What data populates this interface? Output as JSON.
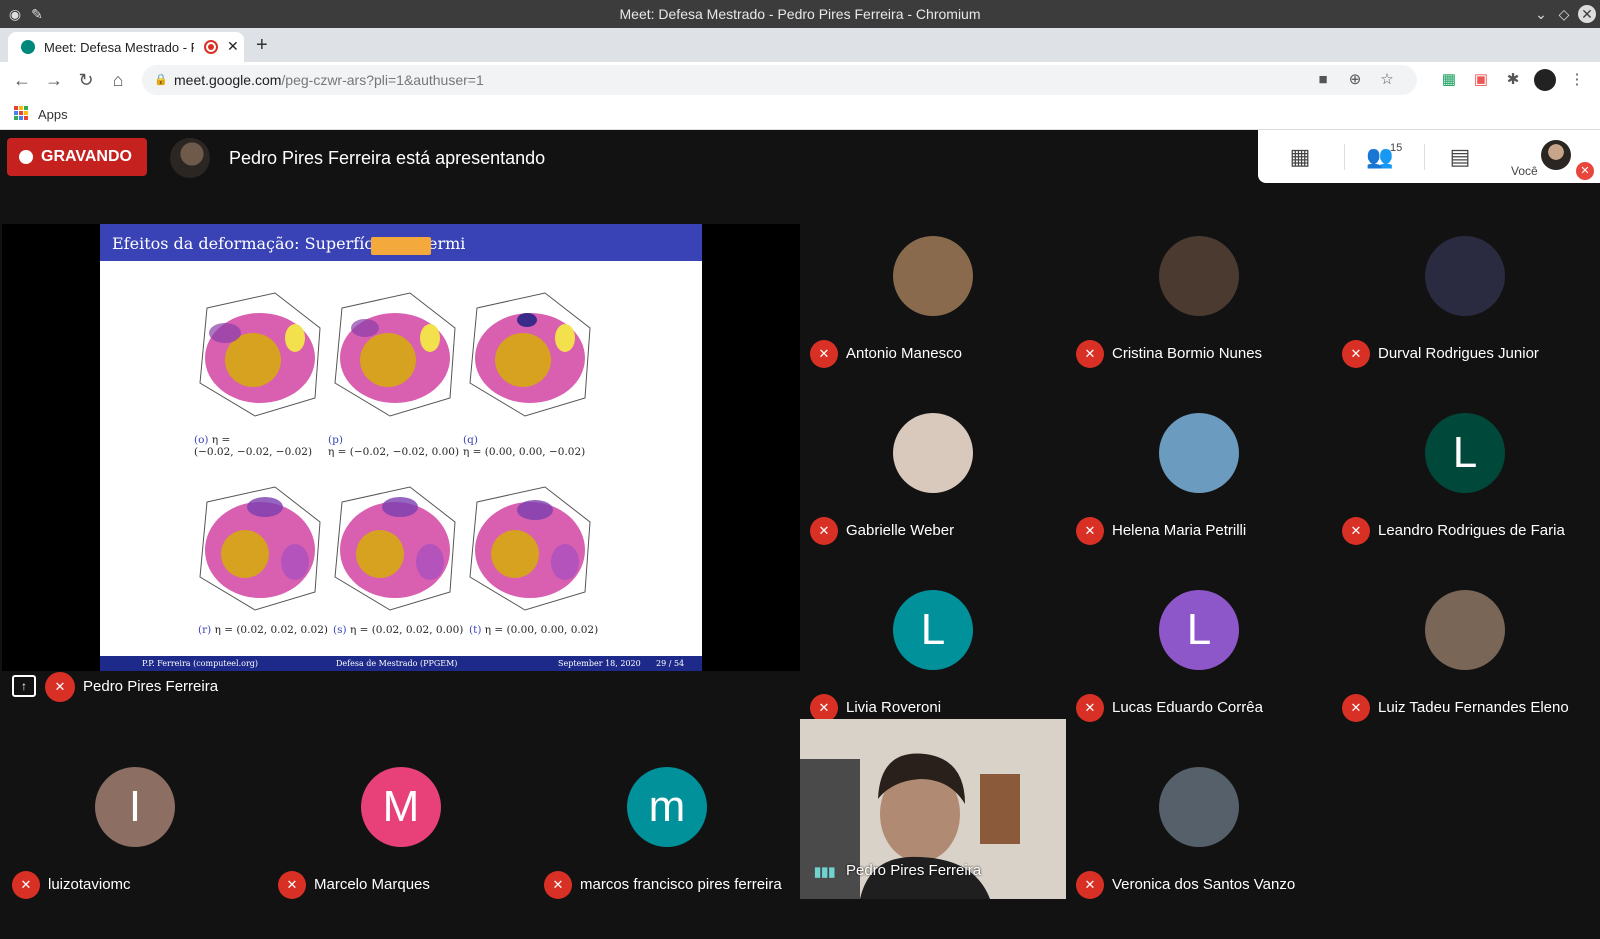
{
  "window": {
    "title": "Meet: Defesa Mestrado - Pedro Pires Ferreira - Chromium"
  },
  "tab": {
    "title": "Meet: Defesa Mestrado - Pedro Pires Ferreira",
    "close": "✕",
    "new_tab": "+"
  },
  "toolbar": {
    "url_host": "meet.google.com",
    "url_path": "/peg-czwr-ars?pli=1&authuser=1"
  },
  "bookmarks": {
    "apps_label": "Apps"
  },
  "meet": {
    "recording_label": "GRAVANDO",
    "presenting_text": "Pedro Pires Ferreira está apresentando",
    "participant_count": "15",
    "self_label": "Você"
  },
  "slide": {
    "title": "Efeitos da deformação: Superfície de Fermi",
    "footer_left": "P.P. Ferreira  (computeel.org)",
    "footer_center": "Defesa de Mestrado (PPGEM)",
    "footer_right": "September 18, 2020",
    "footer_page": "29 / 54",
    "captions": [
      {
        "letter": "(o)",
        "line1": "η =",
        "line2": "(−0.02, −0.02, −0.02)"
      },
      {
        "letter": "(p)",
        "line1": "",
        "line2": "η = (−0.02, −0.02, 0.00)"
      },
      {
        "letter": "(q)",
        "line1": "",
        "line2": "η = (0.00, 0.00, −0.02)"
      },
      {
        "letter": "(r)",
        "line1": "",
        "line2": "η = (0.02, 0.02, 0.02)"
      },
      {
        "letter": "(s)",
        "line1": "",
        "line2": "η = (0.02, 0.02, 0.00)"
      },
      {
        "letter": "(t)",
        "line1": "",
        "line2": "η = (0.00, 0.00, 0.02)"
      }
    ]
  },
  "presenter": {
    "name": "Pedro Pires Ferreira"
  },
  "participants": [
    {
      "name": "Antonio Manesco",
      "initial": "",
      "color": "#8a6a4c"
    },
    {
      "name": "Cristina Bormio Nunes",
      "initial": "",
      "color": "#4a3a30"
    },
    {
      "name": "Durval Rodrigues Junior",
      "initial": "",
      "color": "#2a2a40"
    },
    {
      "name": "Gabrielle Weber",
      "initial": "",
      "color": "#d9c8bc"
    },
    {
      "name": "Helena Maria Petrilli",
      "initial": "",
      "color": "#6b9bbf"
    },
    {
      "name": "Leandro Rodrigues de Faria",
      "initial": "L",
      "color": "#00493a"
    },
    {
      "name": "Livia Roveroni",
      "initial": "L",
      "color": "#00919a"
    },
    {
      "name": "Lucas Eduardo Corrêa",
      "initial": "L",
      "color": "#8e57c9"
    },
    {
      "name": "Luiz Tadeu Fernandes Eleno",
      "initial": "",
      "color": "#7a6656"
    },
    {
      "name": "luizotaviomc",
      "initial": "I",
      "color": "#8d6e63"
    },
    {
      "name": "Marcelo Marques",
      "initial": "M",
      "color": "#e8417a"
    },
    {
      "name": "marcos francisco pires ferreira",
      "initial": "m",
      "color": "#00919a"
    },
    {
      "name": "Veronica dos Santos Vanzo",
      "initial": "",
      "color": "#55606a"
    }
  ],
  "video_tile": {
    "name": "Pedro Pires Ferreira"
  }
}
